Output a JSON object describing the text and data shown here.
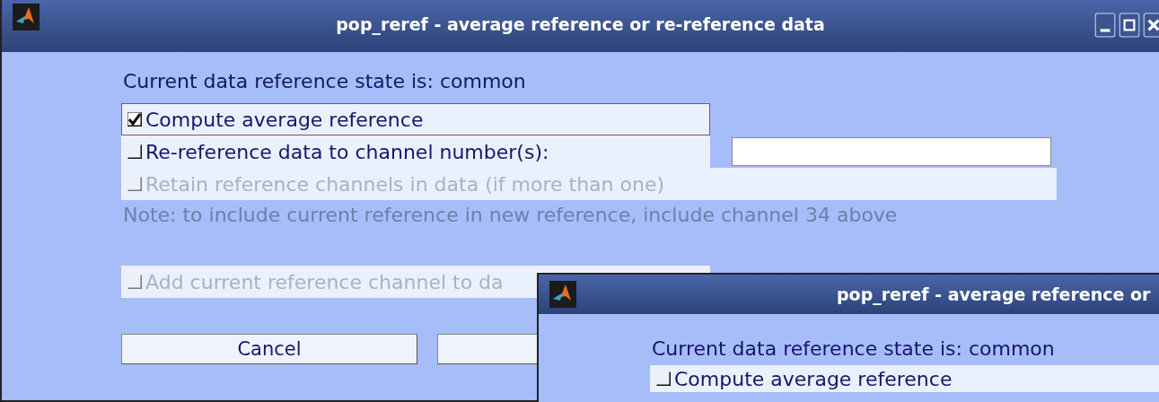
{
  "windows": [
    {
      "title": "pop_reref - average reference or re-reference data",
      "status": "Current data reference state is: common",
      "options": [
        {
          "kind": "checkbox",
          "label": "Compute average reference",
          "checked": true,
          "disabled": false,
          "focused": true
        },
        {
          "kind": "checkbox_input",
          "label": "Re-reference data to channel number(s):",
          "checked": false,
          "disabled": false,
          "focused": false
        },
        {
          "kind": "checkbox",
          "label": "Retain reference channels in data (if more than one)",
          "checked": false,
          "disabled": true,
          "focused": false,
          "wide": true
        },
        {
          "kind": "note",
          "label": "Note: to include current reference in new reference, include channel 34 above",
          "disabled": true
        },
        {
          "kind": "spacer"
        },
        {
          "kind": "checkbox",
          "label": "Add current reference channel to da",
          "checked": false,
          "disabled": true,
          "focused": false
        }
      ],
      "buttons": [
        "Cancel"
      ]
    },
    {
      "title": "pop_reref - average reference or",
      "status": "Current data reference state is: common",
      "options": [
        {
          "kind": "checkbox",
          "label": "Compute average reference",
          "checked": false,
          "disabled": false,
          "focused": false
        }
      ]
    }
  ]
}
